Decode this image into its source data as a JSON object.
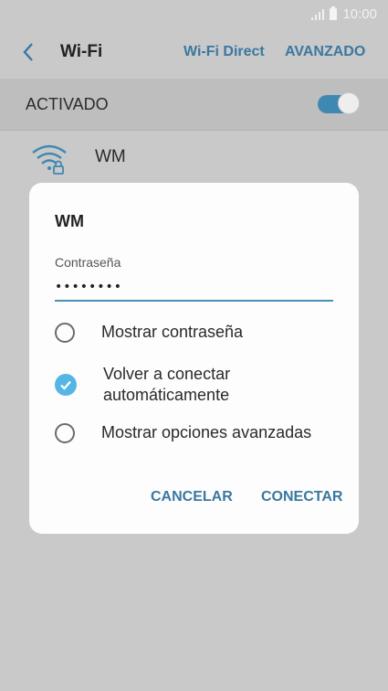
{
  "status_bar": {
    "time": "10:00",
    "signal_icon": "signal-icon",
    "battery_icon": "battery-icon"
  },
  "app_bar": {
    "back_icon": "chevron-left-icon",
    "title": "Wi-Fi",
    "action_wifi_direct": "Wi-Fi Direct",
    "action_advanced": "AVANZADO"
  },
  "master_switch": {
    "label": "ACTIVADO",
    "on": true
  },
  "network": {
    "name": "WM",
    "icon": "wifi-lock-icon"
  },
  "dialog": {
    "title": "WM",
    "password_label": "Contraseña",
    "password_value": "••••••••",
    "options": [
      {
        "label": "Mostrar contraseña",
        "checked": false
      },
      {
        "label": "Volver a conectar automáticamente",
        "checked": true
      },
      {
        "label": "Mostrar opciones avanzadas",
        "checked": false
      }
    ],
    "cancel_label": "CANCELAR",
    "connect_label": "CONECTAR"
  },
  "colors": {
    "accent": "#3a78a0",
    "check": "#55b6e6",
    "scrim": "#c9c9c9"
  }
}
